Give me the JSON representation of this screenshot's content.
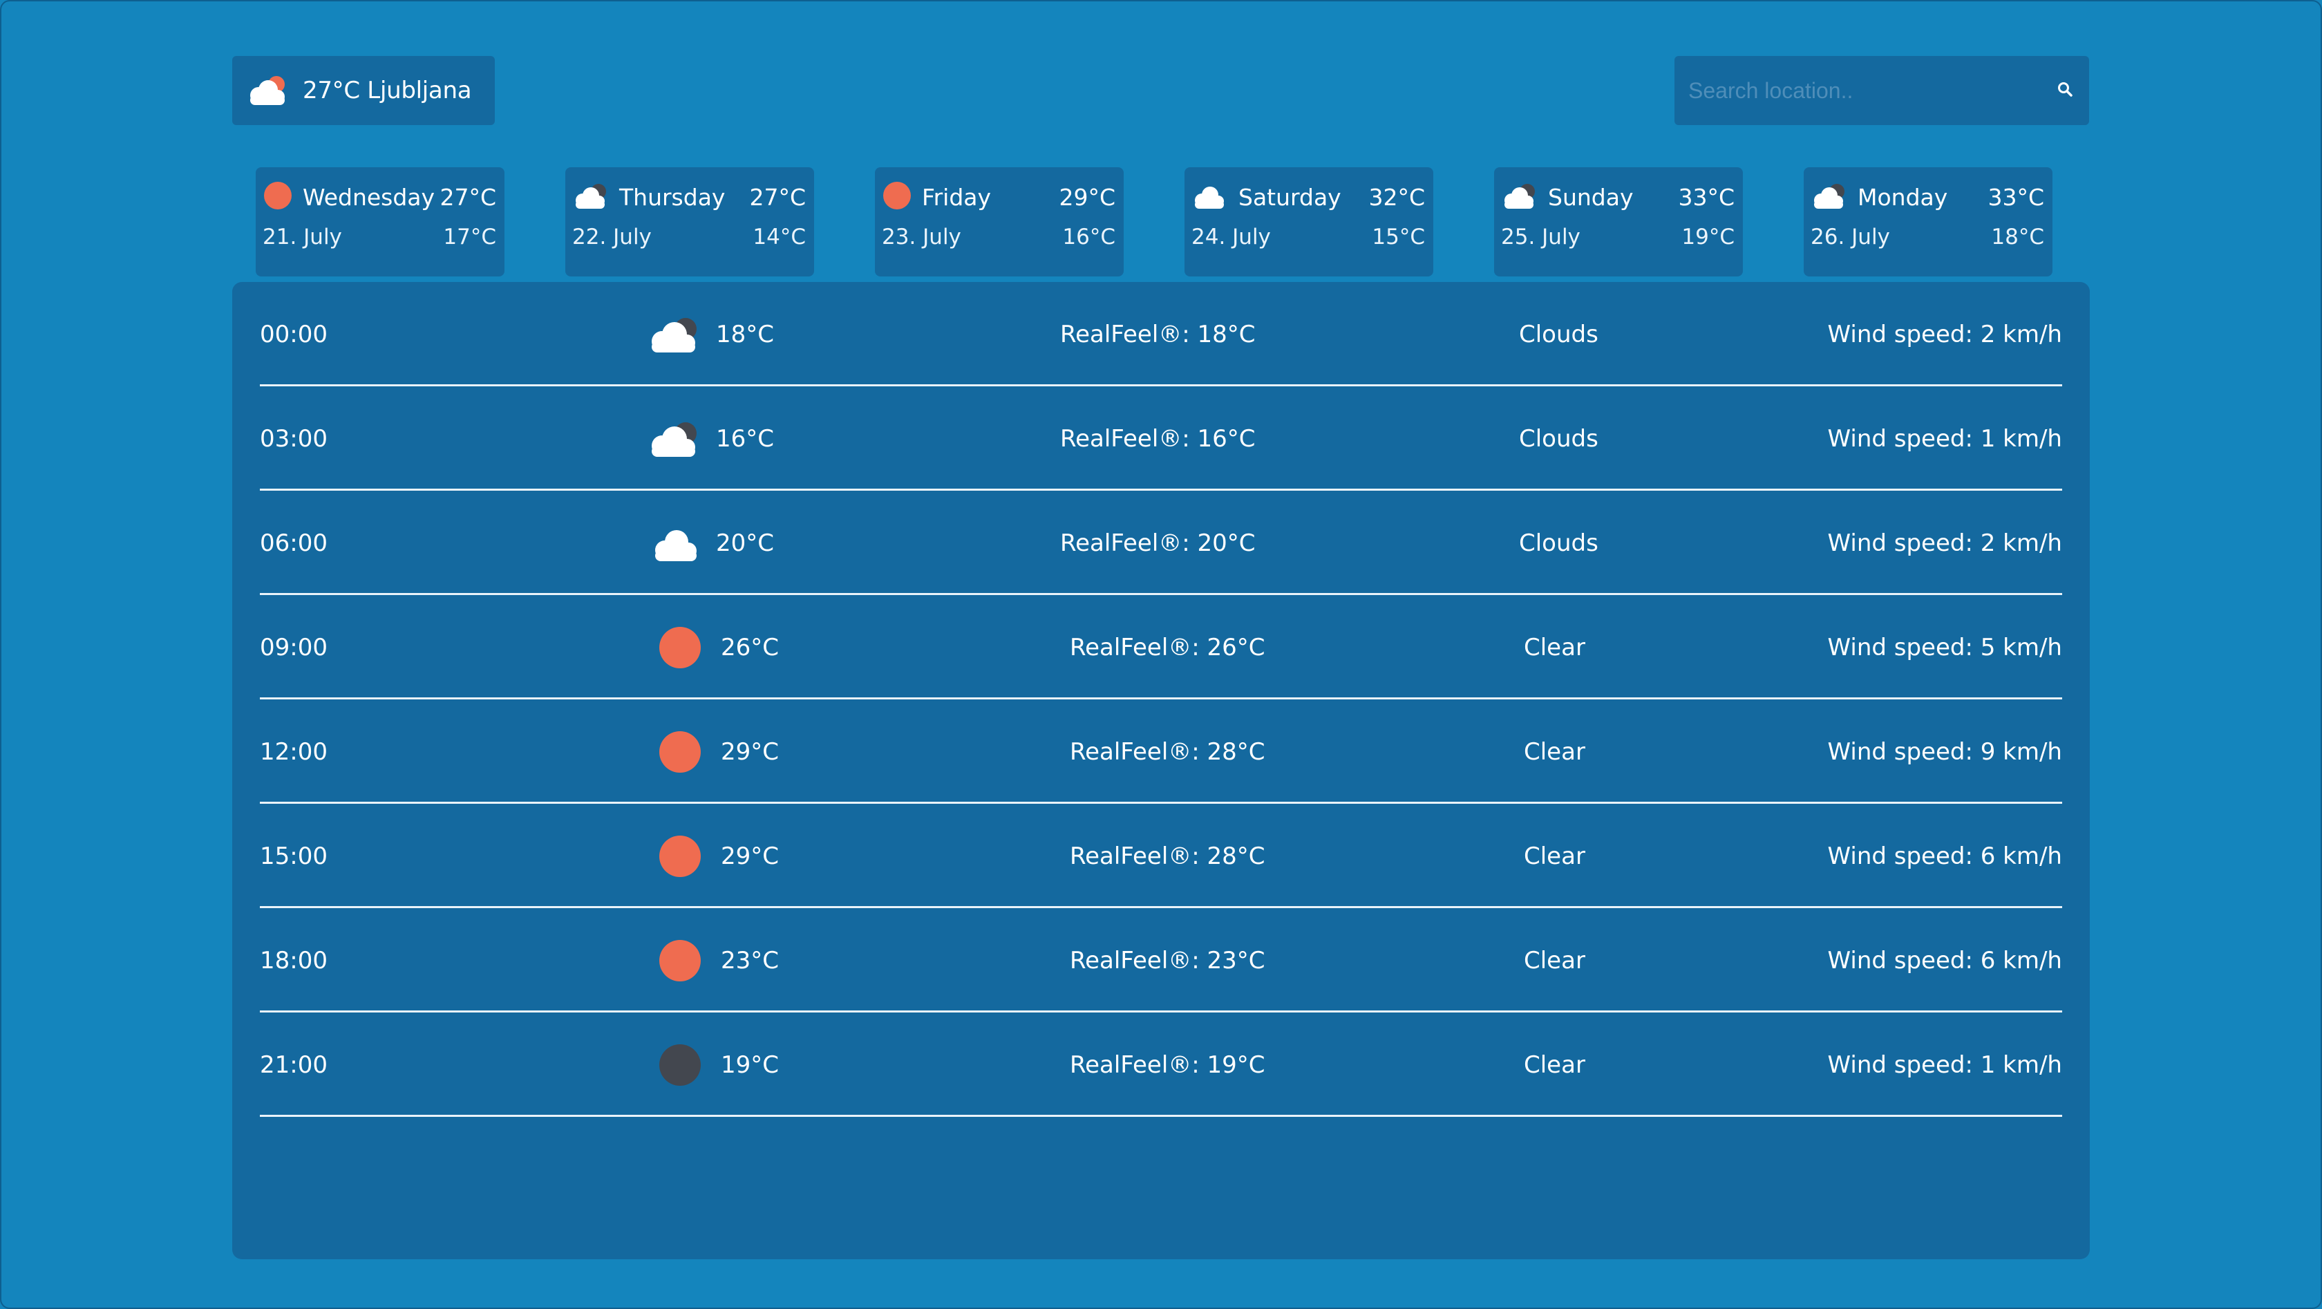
{
  "current": {
    "temperature": "27°C",
    "location": "Ljubljana",
    "label": "27°C Ljubljana",
    "icon": "cloud-sun-icon"
  },
  "search": {
    "placeholder": "Search location..",
    "value": "",
    "icon": "search-icon"
  },
  "days": [
    {
      "name": "Wednesday",
      "date": "21. July",
      "high": "27°C",
      "low": "17°C",
      "icon": "sun-icon"
    },
    {
      "name": "Thursday",
      "date": "22. July",
      "high": "27°C",
      "low": "14°C",
      "icon": "cloud-moon-icon"
    },
    {
      "name": "Friday",
      "date": "23. July",
      "high": "29°C",
      "low": "16°C",
      "icon": "sun-icon"
    },
    {
      "name": "Saturday",
      "date": "24. July",
      "high": "32°C",
      "low": "15°C",
      "icon": "cloud-icon"
    },
    {
      "name": "Sunday",
      "date": "25. July",
      "high": "33°C",
      "low": "19°C",
      "icon": "cloud-moon-icon"
    },
    {
      "name": "Monday",
      "date": "26. July",
      "high": "33°C",
      "low": "18°C",
      "icon": "cloud-moon-icon"
    }
  ],
  "hourly": [
    {
      "time": "00:00",
      "temp": "18°C",
      "realfeel": "RealFeel®: 18°C",
      "description": "Clouds",
      "wind": "Wind speed: 2 km/h",
      "icon": "cloud-moon-icon"
    },
    {
      "time": "03:00",
      "temp": "16°C",
      "realfeel": "RealFeel®: 16°C",
      "description": "Clouds",
      "wind": "Wind speed: 1 km/h",
      "icon": "cloud-moon-icon"
    },
    {
      "time": "06:00",
      "temp": "20°C",
      "realfeel": "RealFeel®: 20°C",
      "description": "Clouds",
      "wind": "Wind speed: 2 km/h",
      "icon": "cloud-icon"
    },
    {
      "time": "09:00",
      "temp": "26°C",
      "realfeel": "RealFeel®: 26°C",
      "description": "Clear",
      "wind": "Wind speed: 5 km/h",
      "icon": "sun-icon"
    },
    {
      "time": "12:00",
      "temp": "29°C",
      "realfeel": "RealFeel®: 28°C",
      "description": "Clear",
      "wind": "Wind speed: 9 km/h",
      "icon": "sun-icon"
    },
    {
      "time": "15:00",
      "temp": "29°C",
      "realfeel": "RealFeel®: 28°C",
      "description": "Clear",
      "wind": "Wind speed: 6 km/h",
      "icon": "sun-icon"
    },
    {
      "time": "18:00",
      "temp": "23°C",
      "realfeel": "RealFeel®: 23°C",
      "description": "Clear",
      "wind": "Wind speed: 6 km/h",
      "icon": "sun-icon"
    },
    {
      "time": "21:00",
      "temp": "19°C",
      "realfeel": "RealFeel®: 19°C",
      "description": "Clear",
      "wind": "Wind speed: 1 km/h",
      "icon": "moon-icon"
    }
  ],
  "colors": {
    "background": "#1485bd",
    "panel": "#14699f",
    "sun": "#ef6c50",
    "moon": "#43474f"
  }
}
